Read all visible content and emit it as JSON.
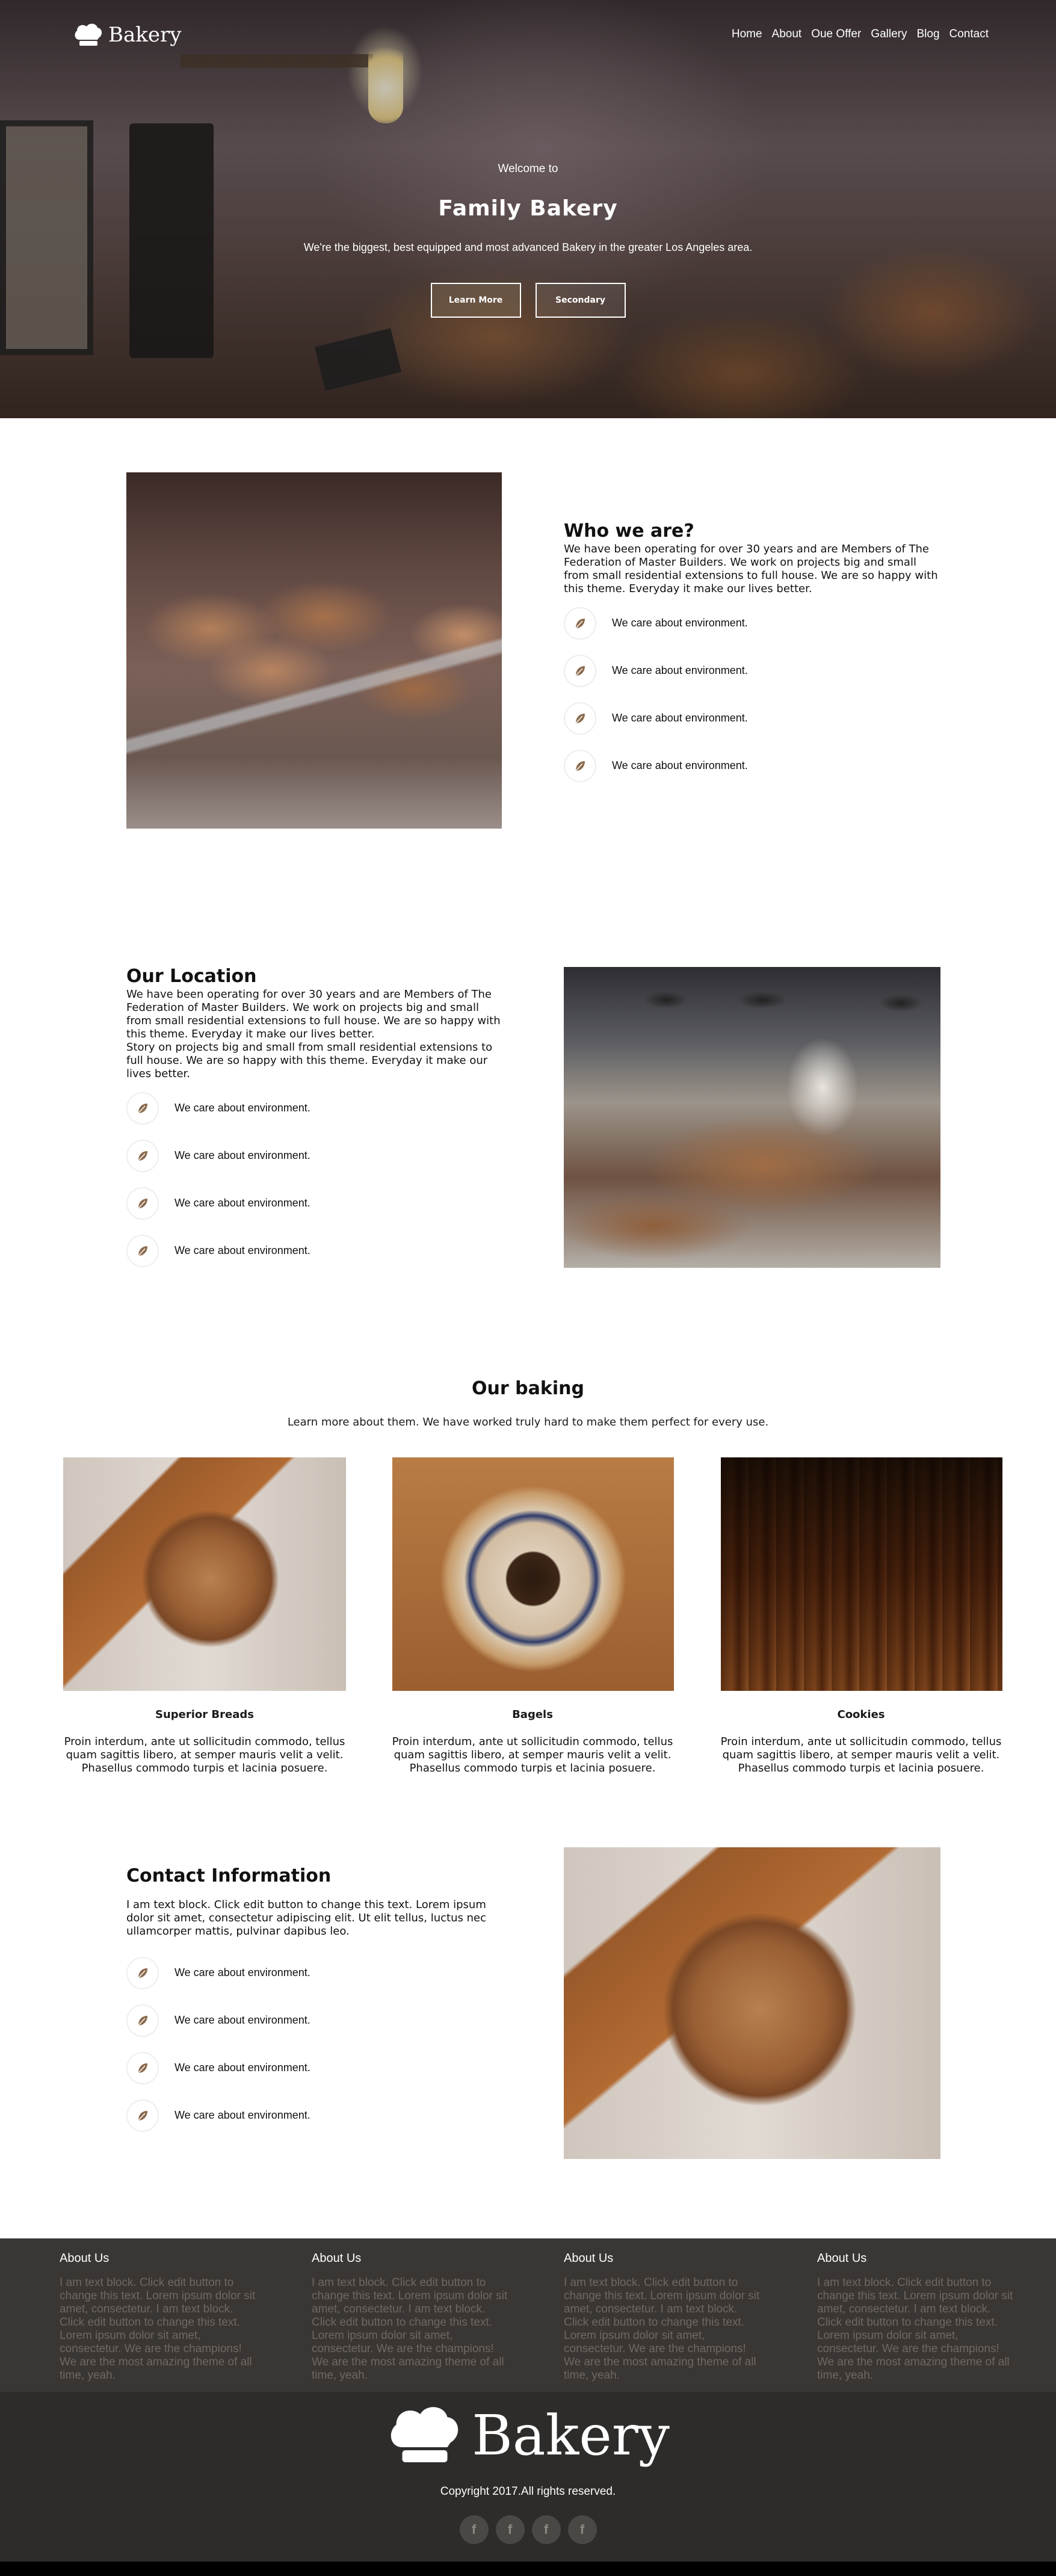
{
  "brand": {
    "name": "Bakery"
  },
  "nav": {
    "items": [
      "Home",
      "About",
      "Oue Offer",
      "Gallery",
      "Blog",
      "Contact"
    ]
  },
  "hero": {
    "welcome": "Welcome to",
    "title": "Family Bakery",
    "subtitle": "We're the biggest, best equipped and most advanced Bakery in the greater Los Angeles area.",
    "primary_button": "Learn More",
    "secondary_button": "Secondary"
  },
  "about": {
    "title": "Who we are?",
    "text": "We have been operating for over 30 years and are Members of The Federation of Master Builders. We work on projects big and small from small residential extensions to full house. We are so happy with this theme. Everyday it make our lives better.",
    "features": [
      "We care about environment.",
      "We care about environment.",
      "We care about environment.",
      "We care about environment."
    ]
  },
  "location": {
    "title": "Our Location",
    "text": "We have been operating for over 30 years and are Members of The Federation of Master Builders. We work on projects big and small from small residential extensions to full house. We are so happy with this theme. Everyday it make our lives better.",
    "text2": "Story on projects big and small from small residential extensions to full house. We are so happy with this theme. Everyday it make our lives better.",
    "features": [
      "We care about environment.",
      "We care about environment.",
      "We care about environment.",
      "We care about environment."
    ]
  },
  "baking": {
    "title": "Our baking",
    "subtitle": "Learn more about them. We have worked truly hard to make them perfect for every use.",
    "cards": [
      {
        "title": "Superior Breads",
        "text": "Proin interdum, ante ut sollicitudin commodo, tellus quam sagittis libero, at semper mauris velit a velit. Phasellus commodo turpis et lacinia posuere."
      },
      {
        "title": "Bagels",
        "text": "Proin interdum, ante ut sollicitudin commodo, tellus quam sagittis libero, at semper mauris velit a velit. Phasellus commodo turpis et lacinia posuere."
      },
      {
        "title": "Cookies",
        "text": "Proin interdum, ante ut sollicitudin commodo, tellus quam sagittis libero, at semper mauris velit a velit. Phasellus commodo turpis et lacinia posuere."
      }
    ]
  },
  "contact": {
    "title": "Contact Information",
    "text": "I am text block. Click edit button to change this text. Lorem ipsum dolor sit amet, consectetur adipiscing elit. Ut elit tellus, luctus nec ullamcorper mattis, pulvinar dapibus leo.",
    "features": [
      "We care about environment.",
      "We care about environment.",
      "We care about environment.",
      "We care about environment."
    ]
  },
  "footer": {
    "columns": [
      {
        "title": "About Us",
        "text": "I am text block. Click edit button to change this text. Lorem ipsum dolor sit amet, consectetur. I am text block. Click edit button to change this text. Lorem ipsum dolor sit amet, consectetur. We are the champions! We are the most amazing theme of all time, yeah."
      },
      {
        "title": "About Us",
        "text": "I am text block. Click edit button to change this text. Lorem ipsum dolor sit amet, consectetur. I am text block. Click edit button to change this text. Lorem ipsum dolor sit amet, consectetur. We are the champions! We are the most amazing theme of all time, yeah."
      },
      {
        "title": "About Us",
        "text": "I am text block. Click edit button to change this text. Lorem ipsum dolor sit amet, consectetur. I am text block. Click edit button to change this text. Lorem ipsum dolor sit amet, consectetur. We are the champions! We are the most amazing theme of all time, yeah."
      },
      {
        "title": "About Us",
        "text": "I am text block. Click edit button to change this text. Lorem ipsum dolor sit amet, consectetur. I am text block. Click edit button to change this text. Lorem ipsum dolor sit amet, consectetur. We are the champions! We are the most amazing theme of all time, yeah."
      }
    ],
    "copyright": "Copyright 2017.All rights reserved.",
    "social_icons": [
      "facebook-icon",
      "facebook-icon",
      "facebook-icon",
      "facebook-icon"
    ],
    "social_glyph": "f"
  },
  "colors": {
    "footer_top": "#3a3633",
    "footer_bottom": "#2e2c2a",
    "leaf_icon": "#8a6a4c"
  }
}
